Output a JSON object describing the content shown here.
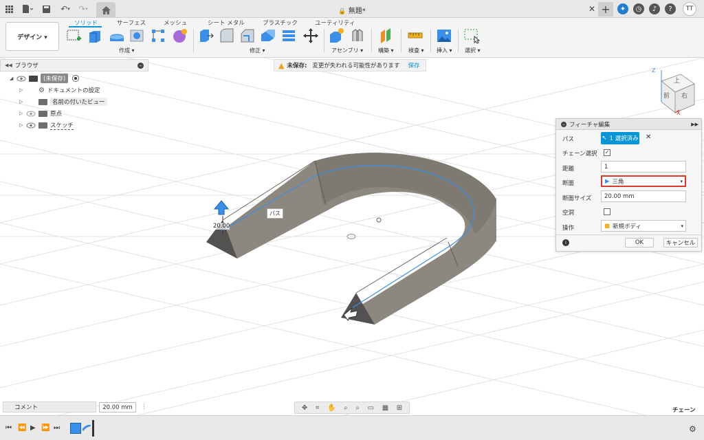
{
  "titlebar": {
    "document_title": "無題*",
    "user_initials": "TT"
  },
  "toolbar": {
    "workspace_label": "デザイン ▾",
    "tabs": [
      "ソリッド",
      "サーフェス",
      "メッシュ",
      "シート メタル",
      "プラスチック",
      "ユーティリティ"
    ],
    "groups": [
      "作成 ▾",
      "修正 ▾",
      "アセンブリ ▾",
      "構築 ▾",
      "検査 ▾",
      "挿入 ▾",
      "選択 ▾"
    ]
  },
  "browser": {
    "title": "ブラウザ",
    "root_label": "(未保存)",
    "items": [
      "ドキュメントの設定",
      "名前の付いたビュー",
      "原点",
      "スケッチ"
    ]
  },
  "warning": {
    "bold": "未保存:",
    "message": "変更が失われる可能性があります",
    "save_link": "保存"
  },
  "viewport": {
    "dimension_value": "20.00",
    "path_tooltip": "パス",
    "viewcube_top": "上",
    "viewcube_front": "前",
    "viewcube_right": "右",
    "axis_z": "Z",
    "axis_x": "X"
  },
  "panel": {
    "title": "フィーチャ編集",
    "path_label": "パス",
    "path_value": "1 選択済み",
    "chain_label": "チェーン選択",
    "distance_label": "距離",
    "distance_value": "1",
    "section_label": "断面",
    "section_value": "三角",
    "section_size_label": "断面サイズ",
    "section_size_value": "20.00 mm",
    "hollow_label": "空洞",
    "operation_label": "操作",
    "operation_value": "新規ボディ",
    "ok": "OK",
    "cancel": "キャンセル"
  },
  "bottom": {
    "comment": "コメント",
    "measure_value": "20.00 mm",
    "chain_hint": "チェーン"
  },
  "colors": {
    "accent": "#0696d7",
    "body_fill": "#8c877f",
    "path_line": "#3a8fe8",
    "highlight_border": "#d9382c"
  }
}
